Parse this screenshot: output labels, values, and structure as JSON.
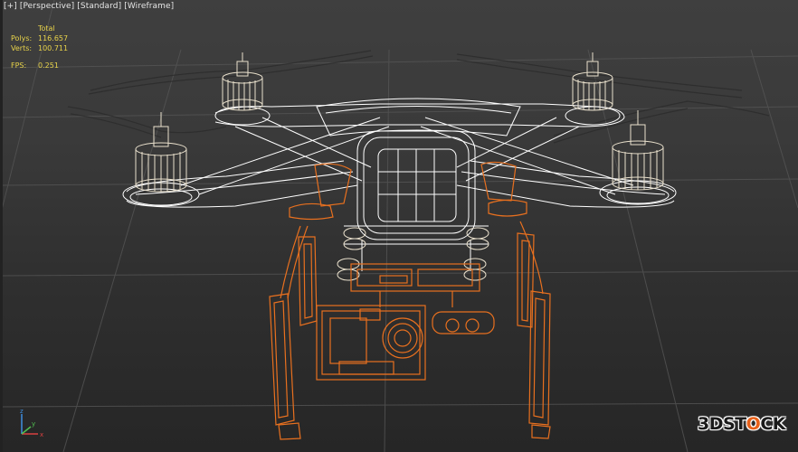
{
  "viewport": {
    "label_parts": [
      "[+]",
      "[Perspective]",
      "[Standard]",
      "[Wireframe]"
    ]
  },
  "stats": {
    "header": "Total",
    "polys_label": "Polys:",
    "polys_value": "116.657",
    "verts_label": "Verts:",
    "verts_value": "100.711",
    "fps_label": "FPS:",
    "fps_value": "0.251"
  },
  "watermark": {
    "part1": "3D",
    "part2": "ST",
    "part3": "O",
    "part4": "CK"
  },
  "axis_gizmo": {
    "x": "x",
    "y": "y",
    "z": "z"
  },
  "colors": {
    "background": "#3a3a3a",
    "frame_wire": "#ffffff",
    "gimbal_wire": "#e8701f",
    "motor_wire": "#e9e0cc",
    "stats_text": "#e8d34a",
    "grid": "#505050"
  }
}
